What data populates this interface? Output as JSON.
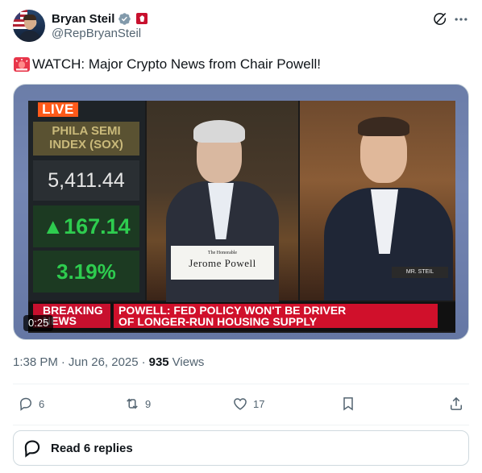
{
  "author": {
    "display_name": "Bryan Steil",
    "handle": "@RepBryanSteil",
    "avatar_icon": "avatar-photo",
    "verified_icon": "verified-badge-icon",
    "affiliation_icon": "us-house-seal-icon"
  },
  "header_actions": {
    "grok_icon": "grok-icon",
    "more_icon": "more-options-icon"
  },
  "tweet": {
    "emoji": "rotating-light-emoji",
    "text": "WATCH: Major Crypto News from Chair Powell!"
  },
  "video": {
    "live_label": "LIVE",
    "index_name_line1": "PHILA SEMI",
    "index_name_line2": "INDEX (SOX)",
    "index_value": "5,411.44",
    "index_change": "167.14",
    "index_pct": "3.19%",
    "nameplate_title": "The Honorable",
    "nameplate_name": "Jerome Powell",
    "steil_plate": "MR. STEIL",
    "breaking_line1": "BREAKING",
    "breaking_line2": "NEWS",
    "headline_line1": "POWELL: FED POLICY WON'T BE DRIVER",
    "headline_line2": "OF LONGER-RUN HOUSING SUPPLY",
    "duration": "0:25"
  },
  "meta": {
    "time": "1:38 PM",
    "sep1": "·",
    "date": "Jun 26, 2025",
    "sep2": "·",
    "views_count": "935",
    "views_label": "Views"
  },
  "actions": {
    "reply_count": "6",
    "repost_count": "9",
    "like_count": "17"
  },
  "read_replies": {
    "label": "Read 6 replies"
  },
  "colors": {
    "accent_blue": "#1d9bf0",
    "text_secondary": "#536471",
    "breaking_red": "#d0102b",
    "ticker_green": "#2ecc4f",
    "live_orange": "#ff5a1a"
  }
}
